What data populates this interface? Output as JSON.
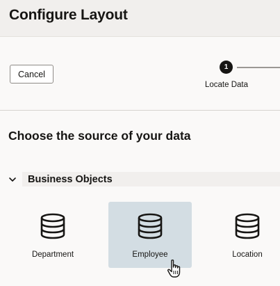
{
  "header": {
    "title": "Configure Layout"
  },
  "toolbar": {
    "cancel_label": "Cancel",
    "steps": [
      {
        "number": "1",
        "label": "Locate Data"
      }
    ]
  },
  "content": {
    "section_title": "Choose the source of your data",
    "groups": [
      {
        "label": "Business Objects",
        "expanded": true,
        "items": [
          {
            "label": "Department",
            "icon": "database-icon",
            "selected": false
          },
          {
            "label": "Employee",
            "icon": "database-icon",
            "selected": true
          },
          {
            "label": "Location",
            "icon": "database-icon",
            "selected": false
          }
        ]
      }
    ]
  },
  "colors": {
    "header_bg": "#f1efed",
    "selected_tile_bg": "#d3dde3",
    "text": "#161513"
  }
}
